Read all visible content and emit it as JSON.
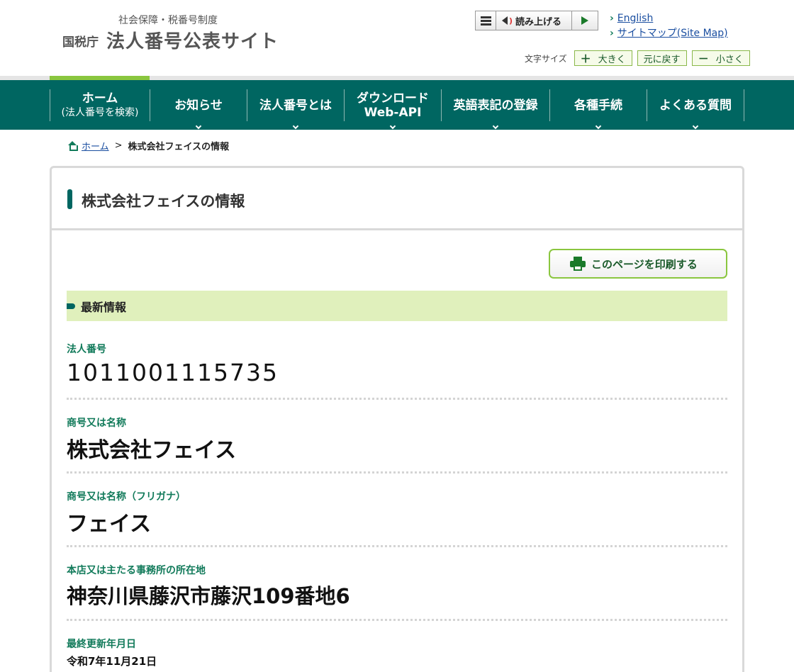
{
  "header": {
    "logo_sub": "社会保障・税番号制度",
    "logo_agency": "国税庁",
    "logo_title": "法人番号公表サイト",
    "read_label": "読み上げる",
    "links": [
      "English",
      "サイトマップ(Site Map)"
    ],
    "font_size_label": "文字サイズ",
    "font_size_buttons": {
      "larger": "大きく",
      "reset": "元に戻す",
      "smaller": "小さく"
    }
  },
  "nav": {
    "items": [
      {
        "line1": "ホーム",
        "line2": "(法人番号を検索)"
      },
      {
        "line1": "お知らせ"
      },
      {
        "line1": "法人番号とは"
      },
      {
        "line1": "ダウンロード",
        "line2": "Web-API"
      },
      {
        "line1": "英語表記の登録"
      },
      {
        "line1": "各種手続"
      },
      {
        "line1": "よくある質問"
      }
    ]
  },
  "breadcrumb": {
    "home": "ホーム",
    "separator": ">",
    "current": "株式会社フェイスの情報"
  },
  "page": {
    "title": "株式会社フェイスの情報",
    "print_label": "このページを印刷する",
    "section_title": "最新情報"
  },
  "fields": [
    {
      "label": "法人番号",
      "value": "1011001115735"
    },
    {
      "label": "商号又は名称",
      "value": "株式会社フェイス"
    },
    {
      "label": "商号又は名称（フリガナ）",
      "value": "フェイス"
    },
    {
      "label": "本店又は主たる事務所の所在地",
      "value": "神奈川県藤沢市藤沢109番地6"
    },
    {
      "label": "最終更新年月日",
      "value": "令和7年11月21日"
    }
  ],
  "colors": {
    "nav_bg": "#006661",
    "accent_green": "#8ac63f",
    "label_green": "#117a5a",
    "band_bg": "#e0f0bc"
  }
}
